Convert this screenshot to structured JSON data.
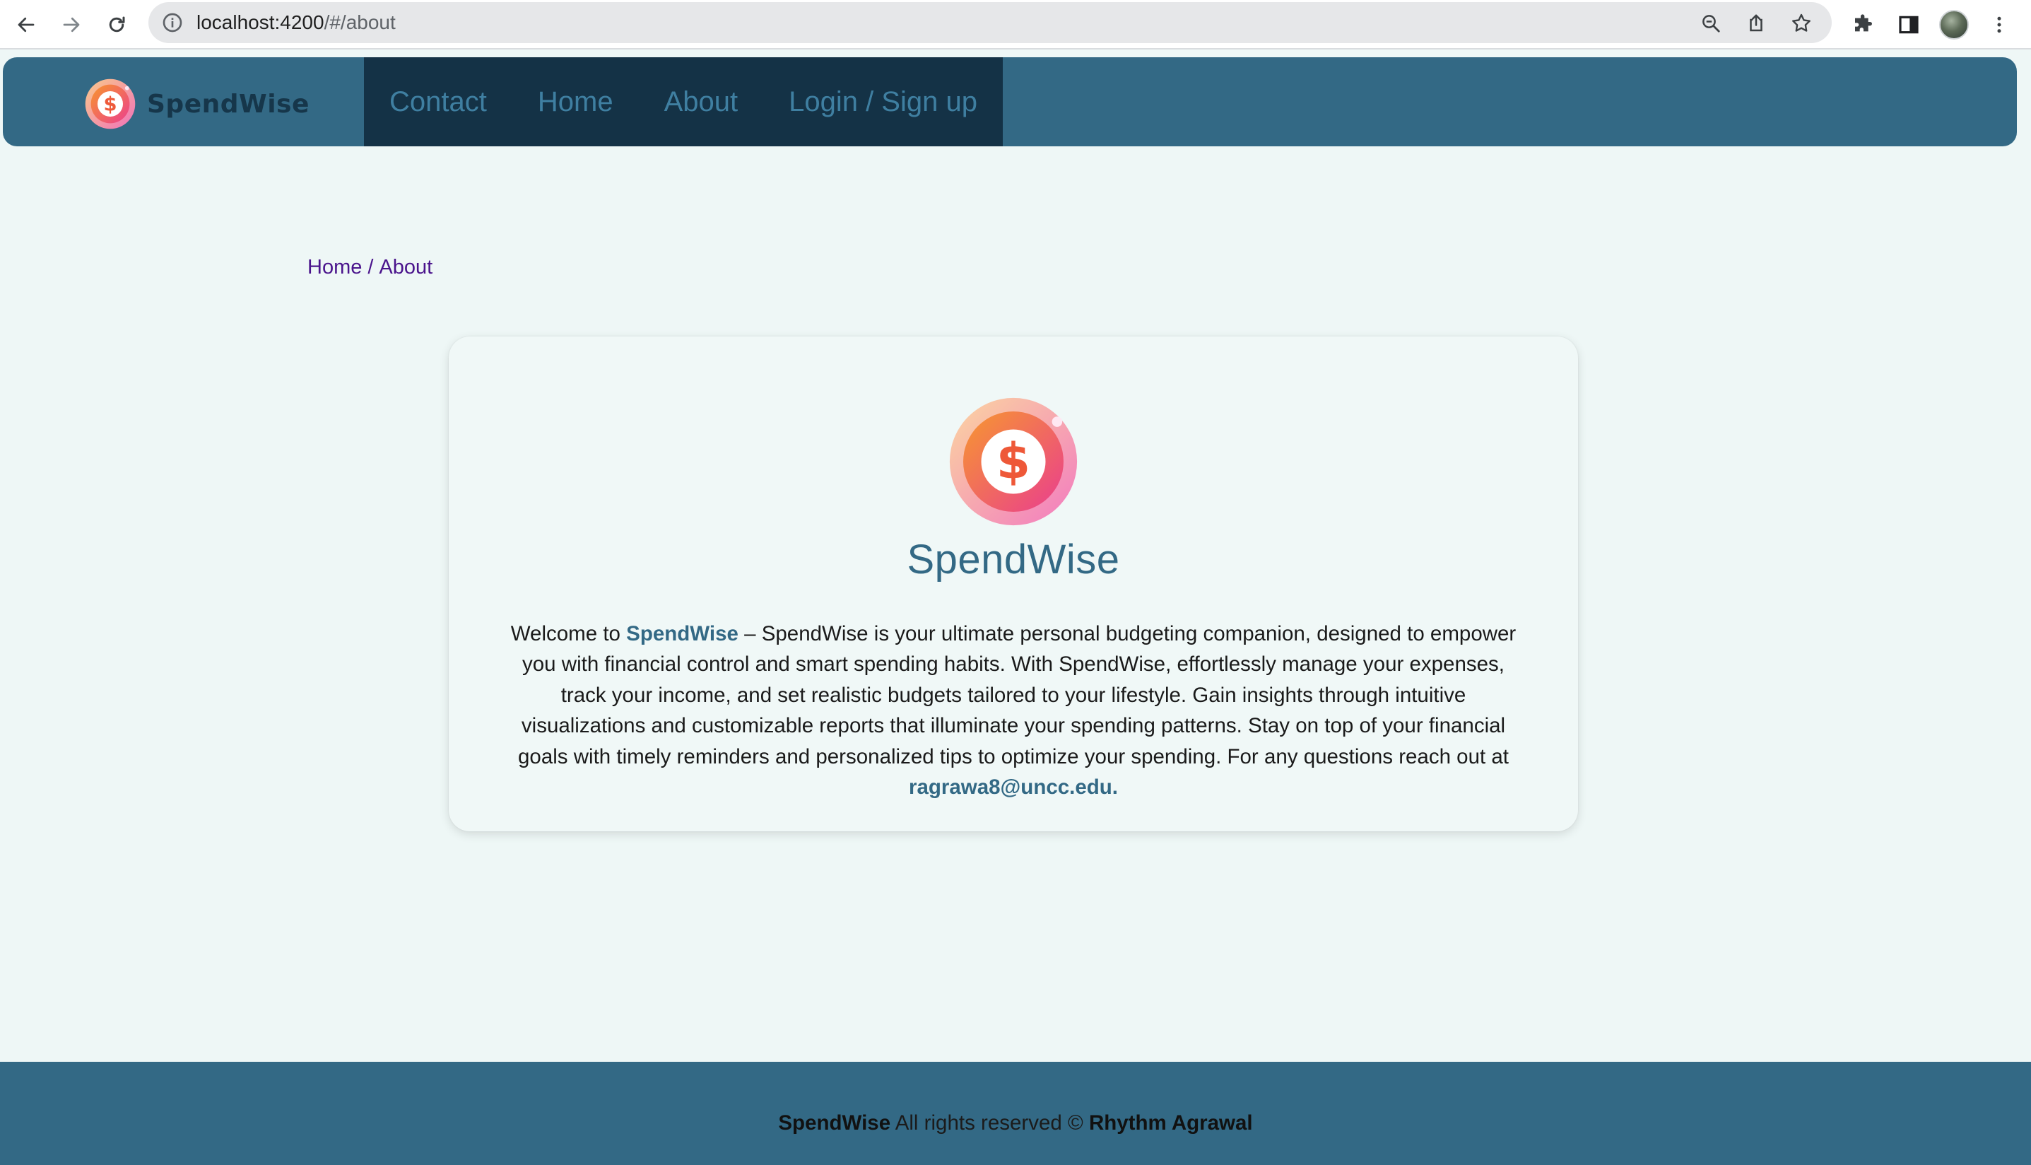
{
  "browser": {
    "url_host": "localhost:4200",
    "url_path": "/#/about",
    "icons": [
      "back-icon",
      "forward-icon",
      "reload-icon",
      "site-info-icon",
      "zoom-icon",
      "share-icon",
      "bookmark-star-icon",
      "extensions-icon",
      "side-panel-icon",
      "profile-avatar",
      "more-menu-icon"
    ]
  },
  "header": {
    "brand_name": "SpendWise",
    "nav": [
      {
        "label": "Contact"
      },
      {
        "label": "Home"
      },
      {
        "label": "About"
      },
      {
        "label": "Login / Sign up"
      }
    ]
  },
  "breadcrumb": {
    "home": "Home",
    "separator": "/",
    "current": "About"
  },
  "about": {
    "title": "SpendWise",
    "intro_prefix": "Welcome to",
    "intro_brand": "SpendWise",
    "description": "– SpendWise is your ultimate personal budgeting companion, designed to empower you with financial control and smart spending habits. With SpendWise, effortlessly manage your expenses, track your income, and set realistic budgets tailored to your lifestyle. Gain insights through intuitive visualizations and customizable reports that illuminate your spending patterns. Stay on top of your financial goals with timely reminders and personalized tips to optimize your spending. For any questions reach out at",
    "email": "ragrawa8@uncc.edu."
  },
  "footer": {
    "brand": "SpendWise",
    "rights": "All rights reserved ©",
    "author": "Rhythm Agrawal"
  },
  "colors": {
    "primary": "#336985",
    "nav_bg": "#143246",
    "nav_link": "#3f7fa1",
    "page_bg": "#eef7f6",
    "breadcrumb": "#4a148c"
  }
}
